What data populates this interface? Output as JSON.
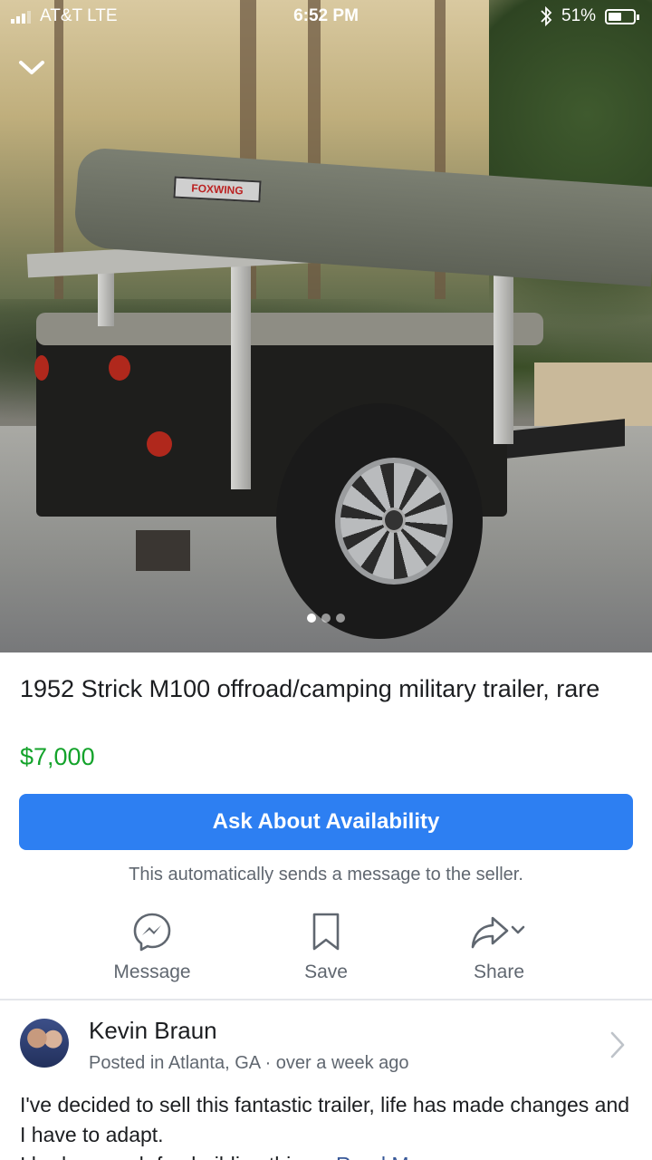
{
  "status_bar": {
    "carrier": "AT&T  LTE",
    "time": "6:52 PM",
    "bluetooth_icon": "bluetooth-icon",
    "battery": "51%"
  },
  "photo": {
    "awning_brand": "FOXWING",
    "page_count": 3,
    "active_page": 1
  },
  "listing": {
    "title": "1952 Strick M100 offroad/camping military trailer, rare",
    "price": "$7,000",
    "cta_label": "Ask About Availability",
    "cta_note": "This automatically sends a message to the seller.",
    "price_color": "#14a32b",
    "cta_color": "#2d7ff2"
  },
  "actions": [
    {
      "label": "Message",
      "icon": "messenger-icon"
    },
    {
      "label": "Save",
      "icon": "bookmark-icon"
    },
    {
      "label": "Share",
      "icon": "share-icon"
    }
  ],
  "seller": {
    "name": "Kevin Braun",
    "location": "Posted in Atlanta, GA",
    "time_ago": "over a week ago"
  },
  "description": {
    "text": "I've decided to sell this fantastic trailer, life has made changes and I have to adapt.",
    "more_visible": "I had so much fun building this. ...",
    "read_more": "Read More"
  }
}
